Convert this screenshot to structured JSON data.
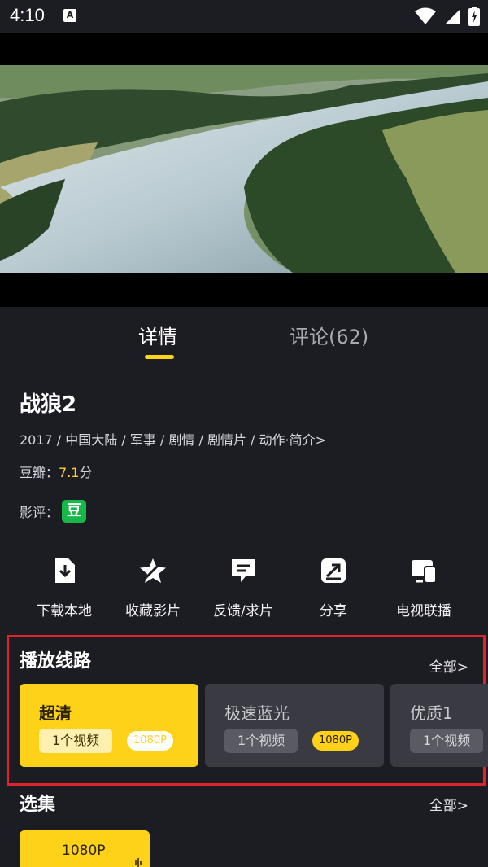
{
  "status_bar": {
    "time": "4:10",
    "notif_letter": "A"
  },
  "colors": {
    "background": "#1c1c23",
    "accent": "#ffd21a",
    "highlight_border": "#e0222c",
    "douban_green": "#16b84a"
  },
  "tabs": [
    {
      "label": "详情",
      "selected": true
    },
    {
      "label": "评论(62)",
      "selected": false
    }
  ],
  "movie": {
    "title": "战狼2",
    "meta": "2017 / 中国大陆 / 军事 / 剧情 / 剧情片 / 动作·简介>",
    "douban_label": "豆瓣：",
    "douban_score": "7.1",
    "douban_unit": "分",
    "review_label": "影评：",
    "review_badge": "豆"
  },
  "actions": [
    {
      "label": "下载本地",
      "icon": "download-icon"
    },
    {
      "label": "收藏影片",
      "icon": "star-icon"
    },
    {
      "label": "反馈/求片",
      "icon": "feedback-icon"
    },
    {
      "label": "分享",
      "icon": "share-icon"
    },
    {
      "label": "电视联播",
      "icon": "tv-cast-icon"
    }
  ],
  "play_lines": {
    "title": "播放线路",
    "all_label": "全部>",
    "items": [
      {
        "name": "超清",
        "count": "1个视频",
        "resolution": "1080P",
        "selected": true
      },
      {
        "name": "极速蓝光",
        "count": "1个视频",
        "resolution": "1080P",
        "selected": false
      },
      {
        "name": "优质1",
        "count": "1个视频",
        "selected": false
      }
    ]
  },
  "episodes": {
    "title": "选集",
    "all_label": "全部>",
    "items": [
      {
        "label": "1080P",
        "playing": true
      }
    ]
  }
}
